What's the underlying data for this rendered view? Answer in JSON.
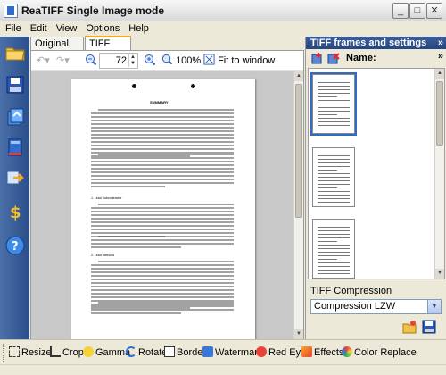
{
  "window": {
    "title": "ReaTIFF Single Image mode"
  },
  "menu": {
    "items": [
      "File",
      "Edit",
      "View",
      "Options",
      "Help"
    ]
  },
  "tabs": [
    {
      "label": "Original image",
      "active": false
    },
    {
      "label": "TIFF image",
      "active": true
    }
  ],
  "viewer_toolbar": {
    "zoom_value": "72",
    "zoom_100_label": "100%",
    "fit_label": "Fit to window"
  },
  "document": {
    "heading": "SUMMARY",
    "sections": [
      "1. Lead Subcontractor",
      "2. Lead Methods"
    ]
  },
  "right_panel": {
    "header": "TIFF frames and settings",
    "header_chevron": "»",
    "name_label": "Name:",
    "tools_chevron": "»",
    "compression_label": "TIFF Compression",
    "compression_value": "Compression LZW"
  },
  "bottom_tools": [
    {
      "label": "Resize",
      "icon": "resize-icon"
    },
    {
      "label": "Crop",
      "icon": "crop-icon"
    },
    {
      "label": "Gamma",
      "icon": "gamma-icon"
    },
    {
      "label": "Rotate",
      "icon": "rotate-icon"
    },
    {
      "label": "Border",
      "icon": "border-icon"
    },
    {
      "label": "Watermark",
      "icon": "watermark-icon"
    },
    {
      "label": "Red Eye",
      "icon": "red-eye-icon"
    },
    {
      "label": "Effects",
      "icon": "effects-icon"
    },
    {
      "label": "Color Replace",
      "icon": "color-replace-icon"
    }
  ],
  "sidebar_icons": [
    "open-folder-icon",
    "save-icon",
    "batch-icon",
    "book-icon",
    "convert-icon",
    "dollar-icon",
    "help-icon"
  ],
  "colors": {
    "sidebar": "#3a5e99",
    "tab_accent": "#f5a623",
    "header": "#2f5490"
  }
}
